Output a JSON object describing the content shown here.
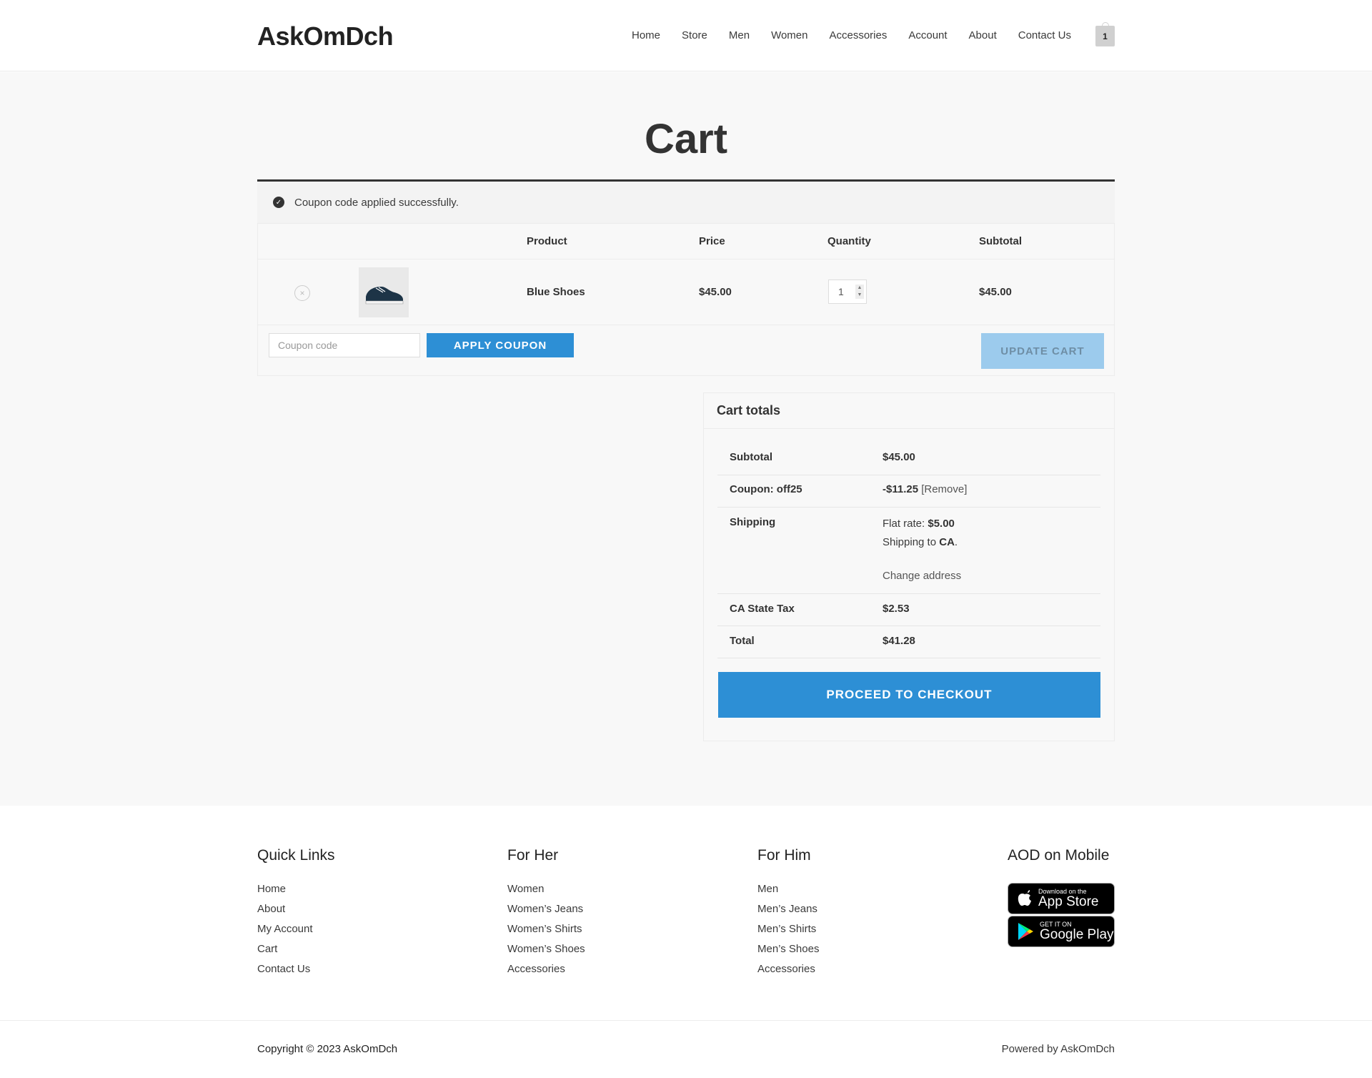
{
  "site": {
    "logo": "AskOmDch",
    "cart_count": "1"
  },
  "nav": [
    "Home",
    "Store",
    "Men",
    "Women",
    "Accessories",
    "Account",
    "About",
    "Contact Us"
  ],
  "page": {
    "title": "Cart"
  },
  "notice": {
    "text": "Coupon code applied successfully."
  },
  "cart": {
    "headers": {
      "product": "Product",
      "price": "Price",
      "quantity": "Quantity",
      "subtotal": "Subtotal"
    },
    "items": [
      {
        "remove": "×",
        "name": "Blue Shoes",
        "price": "$45.00",
        "quantity": "1",
        "subtotal": "$45.00"
      }
    ],
    "coupon_placeholder": "Coupon code",
    "apply_label": "APPLY COUPON",
    "update_label": "UPDATE CART"
  },
  "totals": {
    "heading": "Cart totals",
    "subtotal_label": "Subtotal",
    "subtotal_value": "$45.00",
    "coupon_label": "Coupon: off25",
    "coupon_value": "-$11.25",
    "coupon_remove": "[Remove]",
    "shipping_label": "Shipping",
    "shipping_rate_label": "Flat rate: ",
    "shipping_rate_value": "$5.00",
    "shipping_to_label": "Shipping to ",
    "shipping_to_value": "CA",
    "shipping_to_suffix": ".",
    "change_address": "Change address",
    "tax_label": "CA State Tax",
    "tax_value": "$2.53",
    "total_label": "Total",
    "total_value": "$41.28",
    "checkout_label": "PROCEED TO CHECKOUT"
  },
  "footer": {
    "quick_links": {
      "title": "Quick Links",
      "links": [
        "Home",
        "About",
        "My Account",
        "Cart",
        "Contact Us"
      ]
    },
    "for_her": {
      "title": "For Her",
      "links": [
        "Women",
        "Women’s Jeans",
        "Women’s Shirts",
        "Women’s Shoes",
        "Accessories"
      ]
    },
    "for_him": {
      "title": "For Him",
      "links": [
        "Men",
        "Men’s Jeans",
        "Men’s Shirts",
        "Men’s Shoes",
        "Accessories"
      ]
    },
    "mobile": {
      "title": "AOD on Mobile",
      "app_store_small": "Download on the",
      "app_store_large": "App Store",
      "google_small": "GET IT ON",
      "google_large": "Google Play"
    },
    "copyright": "Copyright © 2023 AskOmDch",
    "powered": "Powered by AskOmDch"
  },
  "colors": {
    "accent": "#2d8fd5",
    "update_disabled": "#9ccbed",
    "main_bg": "#f8f8f8"
  }
}
